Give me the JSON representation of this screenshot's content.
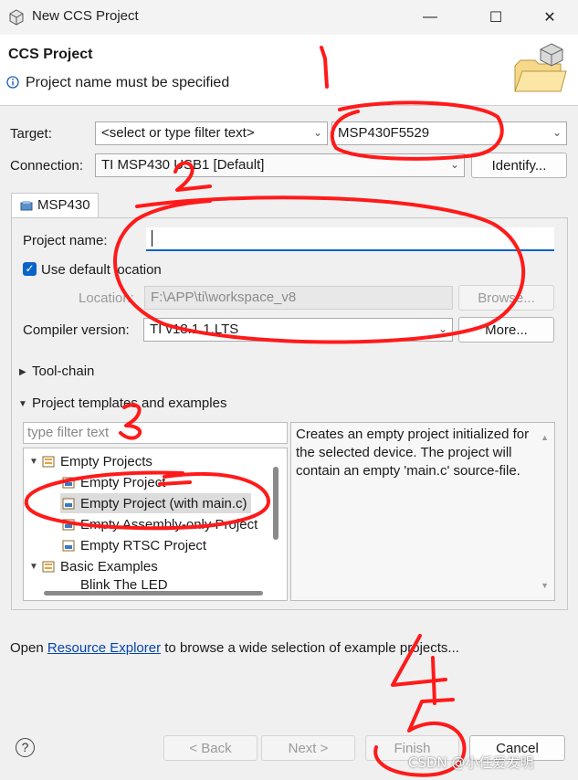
{
  "window": {
    "title": "New CCS Project",
    "minimize_glyph": "—",
    "maximize_glyph": "☐",
    "close_glyph": "✕"
  },
  "banner": {
    "title": "CCS Project",
    "message": "Project name must be specified"
  },
  "target": {
    "label": "Target:",
    "filter_placeholder": "<select or type filter text>",
    "device_value": "MSP430F5529"
  },
  "connection": {
    "label": "Connection:",
    "value": "TI MSP430 USB1 [Default]",
    "identify_button": "Identify..."
  },
  "tab": {
    "label": "MSP430"
  },
  "project": {
    "name_label": "Project name:",
    "name_value": "",
    "use_default_location_label": "Use default location",
    "use_default_location_checked": true,
    "location_label": "Location:",
    "location_value": "F:\\APP\\ti\\workspace_v8",
    "browse_button": "Browse...",
    "compiler_label": "Compiler version:",
    "compiler_value": "TI v18.1.1.LTS",
    "more_button": "More..."
  },
  "sections": {
    "toolchain": "Tool-chain",
    "templates": "Project templates and examples"
  },
  "templates": {
    "filter_placeholder": "type filter text",
    "tree": [
      {
        "label": "Empty Projects",
        "level": 0,
        "expanded": true
      },
      {
        "label": "Empty Project",
        "level": 1
      },
      {
        "label": "Empty Project (with main.c)",
        "level": 1,
        "selected": true
      },
      {
        "label": "Empty Assembly-only Project",
        "level": 1
      },
      {
        "label": "Empty RTSC Project",
        "level": 1
      },
      {
        "label": "Basic Examples",
        "level": 0,
        "expanded": true
      },
      {
        "label": "Blink The LED",
        "level": 1
      }
    ],
    "description": "Creates an empty project initialized for the selected device. The project will contain an empty 'main.c' source-file."
  },
  "footer_note": {
    "prefix": "Open ",
    "link": "Resource Explorer",
    "suffix": " to browse a wide selection of example projects..."
  },
  "buttons": {
    "help": "?",
    "back": "< Back",
    "next": "Next >",
    "finish": "Finish",
    "cancel": "Cancel"
  },
  "annotations": {
    "numbers": [
      "1",
      "2",
      "3",
      "4",
      "5"
    ],
    "stroke_color": "#ff1a1a"
  },
  "watermark": "CSDN @小任爱发明",
  "icons": {
    "app": "cube-icon",
    "info": "info-icon",
    "wizard": "folder-cube-icon",
    "help": "help-icon"
  }
}
